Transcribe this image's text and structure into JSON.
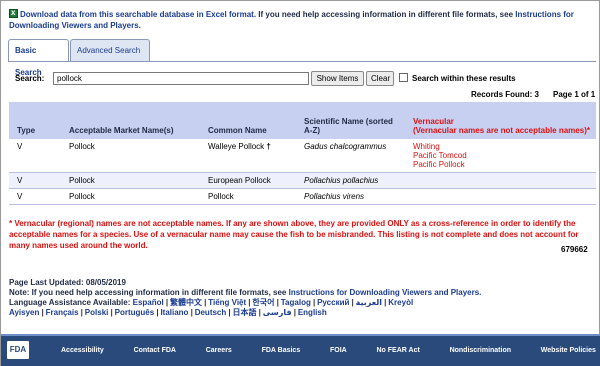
{
  "top_note": {
    "download_link": "Download data from this searchable database in Excel format.",
    "text": " If you need help accessing information in different file formats, see ",
    "instructions_link": "Instructions for Downloading Viewers and Players."
  },
  "tabs": [
    {
      "label": "Basic Search",
      "active": true
    },
    {
      "label": "Advanced Search",
      "active": false
    }
  ],
  "search": {
    "label": "Search:",
    "value": "pollock",
    "show_items_label": "Show Items",
    "clear_label": "Clear",
    "within_label": "Search within these results"
  },
  "results": {
    "records_found": "Records Found: 3",
    "page_of": "Page 1 of 1"
  },
  "table": {
    "headers": {
      "type": "Type",
      "market": "Acceptable Market Name(s)",
      "common": "Common Name",
      "scientific": "Scientific Name (sorted A-Z)",
      "vernacular_title": "Vernacular",
      "vernacular_sub": "(Vernacular names are not acceptable names)*"
    },
    "rows": [
      {
        "type": "V",
        "market": "Pollock",
        "common": "Walleye Pollock",
        "dagger": "†",
        "scientific": "Gadus chalcogrammus",
        "vernacular": [
          "Whiting",
          "Pacific Tomcod",
          "Pacific Pollock"
        ]
      },
      {
        "type": "V",
        "market": "Pollock",
        "common": "European Pollock",
        "dagger": "",
        "scientific": "Pollachius pollachius",
        "vernacular": []
      },
      {
        "type": "V",
        "market": "Pollock",
        "common": "Pollock",
        "dagger": "",
        "scientific": "Pollachius virens",
        "vernacular": []
      }
    ]
  },
  "warning": "* Vernacular (regional) names are not acceptable names. If any are shown above, they are provided ONLY as a cross-reference in order to identify the acceptable names for a species. Use of a vernacular name may cause the fish to be misbranded. This listing is not complete and does not account for many names used around the world.",
  "counter": "679662",
  "footer": {
    "last_updated": "Page Last Updated: 08/05/2019",
    "note_prefix": "Note: If you need help accessing information in different file formats, see ",
    "note_link": "Instructions for Downloading Viewers and Players.",
    "lang_prefix": "Language Assistance Available: ",
    "languages": [
      "Español",
      "繁體中文",
      "Tiếng Việt",
      "한국어",
      "Tagalog",
      "Русский",
      "العربية",
      "Kreyòl Ayisyen",
      "Français",
      "Polski",
      "Português",
      "Italiano",
      "Deutsch",
      "日本語",
      "فارسی",
      "English"
    ]
  },
  "fda_bar": {
    "logo": "FDA",
    "links": [
      "Accessibility",
      "Contact FDA",
      "Careers",
      "FDA Basics",
      "FOIA",
      "No FEAR Act",
      "Nondiscrimination",
      "Website Policies"
    ]
  },
  "colors": {
    "header_bg": "#c8d0f2",
    "vernacular_red": "#dd1111",
    "fda_blue": "#2a4a7b",
    "link_blue": "#1b3c8f"
  }
}
